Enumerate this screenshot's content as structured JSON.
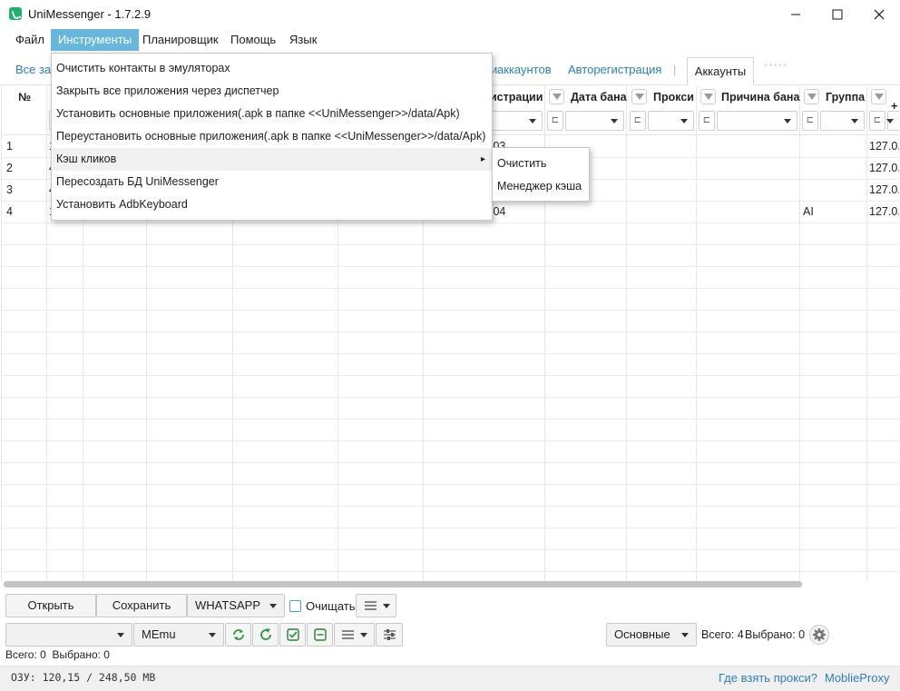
{
  "app": {
    "title": "UniMessenger - 1.7.2.9"
  },
  "menu": {
    "file": "Файл",
    "tools": "Инструменты",
    "scheduler": "Планировщик",
    "help": "Помощь",
    "language": "Язык"
  },
  "toolbar": {
    "all_tasks": "Все зад",
    "accounts_link": "аккаунтов",
    "prefix_char": "и",
    "autoreg": "Авторегистрация",
    "separator": "|",
    "tab_accounts": "Аккаунты",
    "tab_ghost": "*****"
  },
  "table": {
    "columns": {
      "number": "№",
      "registration": "истрации",
      "ban_date": "Дата бана",
      "proxy": "Прокси",
      "ban_reason": "Причина бана",
      "group": "Группа",
      "add_col": "+"
    },
    "filter_op": "⊏",
    "rows": [
      {
        "num": "1",
        "c1": "1",
        "reg": ":03",
        "group": "",
        "host": "127.0."
      },
      {
        "num": "2",
        "c1": "4",
        "reg": "",
        "group": "",
        "host": "127.0."
      },
      {
        "num": "3",
        "c1": "4",
        "reg": "",
        "group": "",
        "host": "127.0."
      },
      {
        "num": "4",
        "c1": "1",
        "reg": ":04",
        "group": "AI",
        "host": "127.0."
      }
    ]
  },
  "tools_menu": {
    "items": [
      "Очистить контакты в эмуляторах",
      "Закрыть все приложения через диспетчер",
      "Установить основные приложения(.apk в папке <<UniMessenger>>/data/Apk)",
      "Переустановить основные приложения(.apk в папке <<UniMessenger>>/data/Apk)",
      "Кэш кликов",
      "Пересоздать БД UniMessenger",
      "Установить AdbKeyboard"
    ],
    "submenu": [
      "Очистить",
      "Менеджер кэша"
    ],
    "submenu_arrow": "▸"
  },
  "bottom": {
    "open": "Открыть",
    "save": "Сохранить",
    "messenger": "WHATSAPP",
    "clear_label": "Очищать",
    "emulator_left": "",
    "emulator": "MEmu",
    "view": "Основные",
    "total": "Всего: 4",
    "selected": "Выбрано: 0",
    "summary": "Всего: 0  Выбрано: 0"
  },
  "status": {
    "ram": "ОЗУ: 120,15 / 248,50 МВ",
    "proxy_link": "Где взять прокси?",
    "mobile_proxy": "MoblieProxy"
  },
  "colors": {
    "accent": "#67b7dc",
    "link": "#2a7fbd",
    "green": "#2b9a3a"
  }
}
